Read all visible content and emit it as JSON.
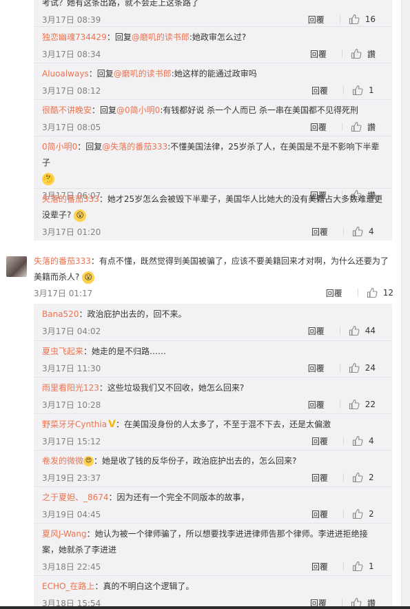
{
  "labels": {
    "reply": "回覆",
    "like_zero": "讚"
  },
  "top_thread": [
    {
      "user": "",
      "mention": "",
      "text": "考试？她有这条出路，就不会走上这条路了",
      "time": "3月17日 08:39",
      "likes": "16"
    },
    {
      "user": "独恋幽魂734429",
      "mention": "@磨叽的读书郎",
      "text": ":她政审怎么过?",
      "time": "3月17日 08:34",
      "likes": "讚"
    },
    {
      "user": "Aluoalways",
      "mention": "@磨叽的读书郎",
      "text": ":她这样的能通过政审吗",
      "time": "3月17日 08:12",
      "likes": "1"
    },
    {
      "user": "很酷不讲晚安",
      "mention": "@0简小明0",
      "text": ":有钱都好说 杀一个人而已 杀一串在美国都不见得死刑",
      "time": "3月17日 08:05",
      "likes": "讚"
    },
    {
      "user": "0简小明0",
      "mention": "@失落的番茄333",
      "text": ":不懂美国法律，25岁杀了人，在美国是不是不影响下半辈子",
      "time": "3月17日 06:07",
      "likes": "讚",
      "emoji": "🤔"
    },
    {
      "user": "失落的番茄333",
      "mention": "",
      "text": "：她才25岁怎么会被毁下半辈子，美国华人比她大的没有美籍占大多数难道更没辈子?",
      "time": "3月17日 01:20",
      "likes": "4",
      "emoji": "😮"
    }
  ],
  "main_comment": {
    "user": "失落的番茄333",
    "text": "：有点不懂，既然觉得到美国被骗了，应该不要美籍回来才对啊，为什么还要为了美籍而杀人?",
    "emoji": "😮",
    "time": "3月17日 01:17",
    "likes": "12"
  },
  "bottom_thread": [
    {
      "user": "Bana520",
      "text": "：政治庇护出去的，回不来。",
      "time": "3月17日 04:02",
      "likes": "44"
    },
    {
      "user": "夏虫飞起来",
      "text": "：她走的是不归路……",
      "time": "3月17日 11:30",
      "likes": "24"
    },
    {
      "user": "雨里看阳光123",
      "text": "：这些垃圾我们又不回收，她怎么回来?",
      "time": "3月17日 10:28",
      "likes": "22"
    },
    {
      "user": "野菜牙牙Cynthia",
      "badge": "V",
      "text": "：在美国没身份的人太多了，不至于混不下去，还是太偏激",
      "time": "3月17日 15:12",
      "likes": "4"
    },
    {
      "user": "卷发的微微",
      "emoji": "😍",
      "text": "：她是收了钱的反华份子，政治庇护出去的，怎么回来?",
      "time": "3月19日 23:37",
      "likes": "2"
    },
    {
      "user": "之于夏妲、_8674",
      "text": "：因为还有一个完全不同版本的故事，",
      "time": "3月19日 04:45",
      "likes": "2"
    },
    {
      "user": "夏风J-Wang",
      "text": "：她认为被一个律师骗了，所以想要找李进进律师告那个律师。李进进拒绝接案，她就杀了李进进",
      "time": "3月18日 22:45",
      "likes": "1"
    },
    {
      "user": "ECHO_在路上",
      "text": "：真的不明白这个逻辑了。",
      "time": "3月18日 15:54",
      "likes": "讚"
    }
  ],
  "colors": {
    "username": "#eb7350",
    "panel": "#f2f2f5",
    "time": "#808080"
  }
}
